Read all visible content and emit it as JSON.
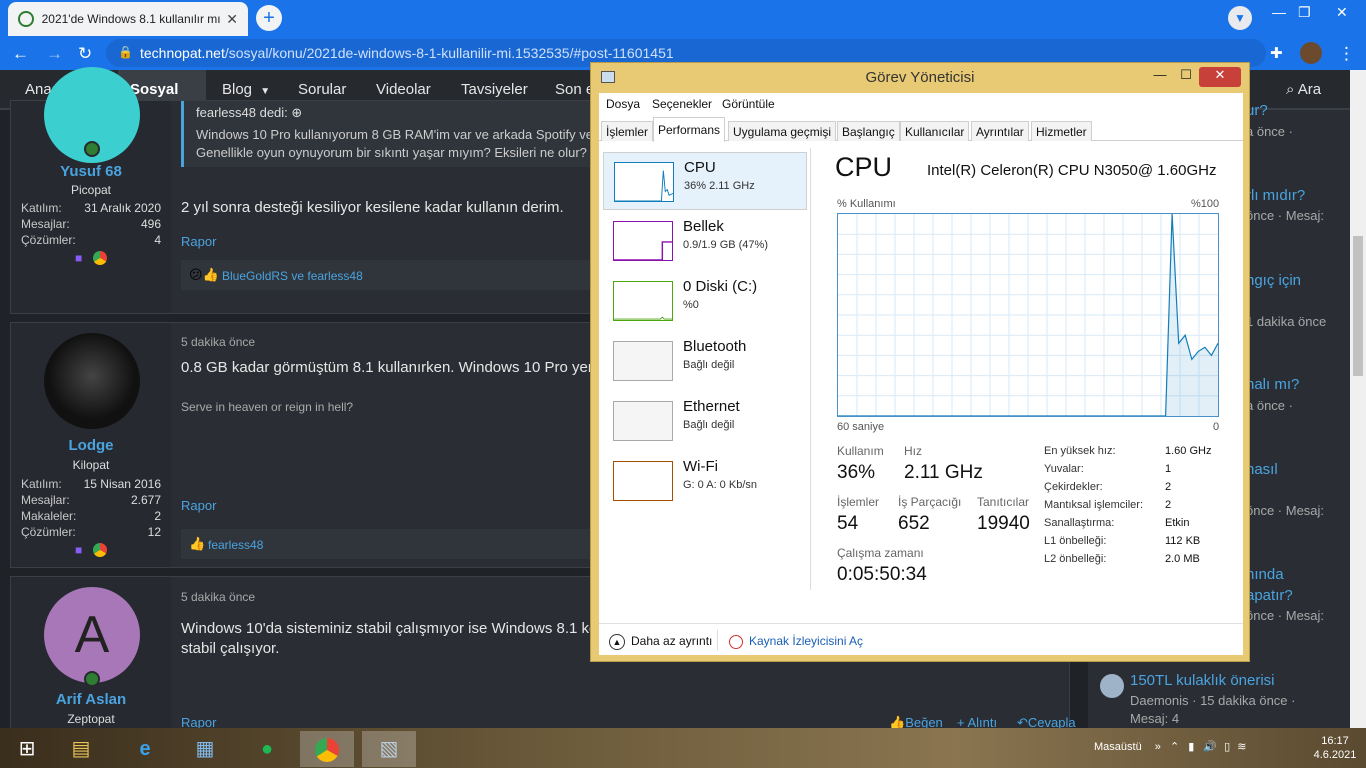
{
  "browser": {
    "tab_title": "2021'de Windows 8.1 kullanılır mı",
    "new_tab": "+",
    "url_domain": "technopat.net",
    "url_path": "/sosyal/konu/2021de-windows-8-1-kullanilir-mi.1532535/#post-11601451"
  },
  "sitenav": {
    "items": [
      "Anasayfa",
      "Sosyal",
      "Blog",
      "Sorular",
      "Videolar",
      "Tavsiyeler",
      "Son e"
    ],
    "search": "Ara"
  },
  "posts": [
    {
      "user": "Yusuf 68",
      "role": "Picopat",
      "stats": [
        [
          "Katılım:",
          "31 Aralık 2020"
        ],
        [
          "Mesajlar:",
          "496"
        ],
        [
          "Çözümler:",
          "4"
        ]
      ],
      "quote_header": "fearless48 dedi:",
      "quote": "Windows 10 Pro kullanıyorum 8 GB RAM'im var ve arkada Spotify ve",
      "quote2": "Genellikle oyun oynuyorum bir sıkıntı yaşar mıyım? Eksileri ne olur?",
      "text": "2 yıl sonra desteği kesiliyor kesilene kadar kullanın derim.",
      "report": "Rapor",
      "reactions": "BlueGoldRS ve fearless48"
    },
    {
      "user": "Lodge",
      "role": "Kilopat",
      "stats": [
        [
          "Katılım:",
          "15 Nisan 2016"
        ],
        [
          "Mesajlar:",
          "2.677"
        ],
        [
          "Makaleler:",
          "2"
        ],
        [
          "Çözümler:",
          "12"
        ]
      ],
      "time": "5 dakika önce",
      "text": "0.8 GB kadar görmüştüm 8.1 kullanırken. Windows 10 Pro yeri",
      "signature": "Serve in heaven or reign in hell?",
      "report": "Rapor",
      "reactions": "fearless48"
    },
    {
      "user": "Arif Aslan",
      "role": "Zeptopat",
      "initial": "A",
      "time": "5 dakika önce",
      "text": "Windows 10'da sisteminiz stabil çalışmıyor ise Windows 8.1 ke",
      "text2": "stabil çalışıyor.",
      "report": "Rapor",
      "actions": [
        "Beğen",
        "+ Alıntı",
        "Cevapla"
      ]
    }
  ],
  "sidebar": {
    "frag": [
      "ur?",
      "a önce ·",
      "rlı mıdır?",
      "önce · Mesaj:",
      "ngıç için",
      "1 dakika önce",
      "nalı mı?",
      "a önce ·",
      "nasıl",
      "önce · Mesaj:",
      "nında",
      "apatır?",
      "önce · Mesaj:"
    ],
    "last_title": "150TL kulaklık önerisi",
    "last_sub": "Daemonis · 15 dakika önce ·",
    "last_msg": "Mesaj: 4"
  },
  "taskmanager": {
    "title": "Görev Yöneticisi",
    "menu": [
      "Dosya",
      "Seçenekler",
      "Görüntüle"
    ],
    "tabs": [
      "İşlemler",
      "Performans",
      "Uygulama geçmişi",
      "Başlangıç",
      "Kullanıcılar",
      "Ayrıntılar",
      "Hizmetler"
    ],
    "resources": [
      {
        "name": "CPU",
        "detail": "36% 2.11 GHz",
        "color": "#117dbb"
      },
      {
        "name": "Bellek",
        "detail": "0.9/1.9 GB (47%)",
        "color": "#8b12ae"
      },
      {
        "name": "0 Diski (C:)",
        "detail": "%0",
        "color": "#4da60c"
      },
      {
        "name": "Bluetooth",
        "detail": "Bağlı değil",
        "color": "#aaaaaa"
      },
      {
        "name": "Ethernet",
        "detail": "Bağlı değil",
        "color": "#aaaaaa"
      },
      {
        "name": "Wi-Fi",
        "detail": "G: 0 A: 0 Kb/sn",
        "color": "#a74f01"
      }
    ],
    "heading": "CPU",
    "cpu_name": "Intel(R) Celeron(R) CPU N3050@ 1.60GHz",
    "graph_label": "% Kullanımı",
    "graph_max": "%100",
    "graph_span": "60 saniye",
    "graph_min": "0",
    "graph_samples": [
      0,
      0,
      0,
      0,
      0,
      0,
      0,
      0,
      0,
      0,
      0,
      0,
      0,
      0,
      0,
      0,
      0,
      0,
      0,
      0,
      0,
      0,
      0,
      0,
      0,
      0,
      0,
      0,
      0,
      0,
      0,
      0,
      0,
      0,
      0,
      0,
      0,
      0,
      0,
      0,
      0,
      0,
      0,
      0,
      0,
      0,
      0,
      0,
      0,
      0,
      0,
      100,
      36,
      40,
      28,
      32,
      34,
      30,
      36
    ],
    "stats": {
      "usage_label": "Kullanım",
      "usage": "36%",
      "speed_label": "Hız",
      "speed": "2.11 GHz",
      "proc_label": "İşlemler",
      "proc": "54",
      "threads_label": "İş Parçacığı",
      "threads": "652",
      "handles_label": "Tanıtıcılar",
      "handles": "19940",
      "uptime_label": "Çalışma zamanı",
      "uptime": "0:05:50:34"
    },
    "specs": [
      [
        "En yüksek hız:",
        "1.60 GHz"
      ],
      [
        "Yuvalar:",
        "1"
      ],
      [
        "Çekirdekler:",
        "2"
      ],
      [
        "Mantıksal işlemciler:",
        "2"
      ],
      [
        "Sanallaştırma:",
        "Etkin"
      ],
      [
        "L1 önbelleği:",
        "112 KB"
      ],
      [
        "L2 önbelleği:",
        "2.0 MB"
      ]
    ],
    "fewer_details": "Daha az ayrıntı",
    "resource_monitor": "Kaynak İzleyicisini Aç"
  },
  "taskbar": {
    "desktop": "Masaüstü",
    "time": "16:17",
    "date": "4.6.2021"
  }
}
